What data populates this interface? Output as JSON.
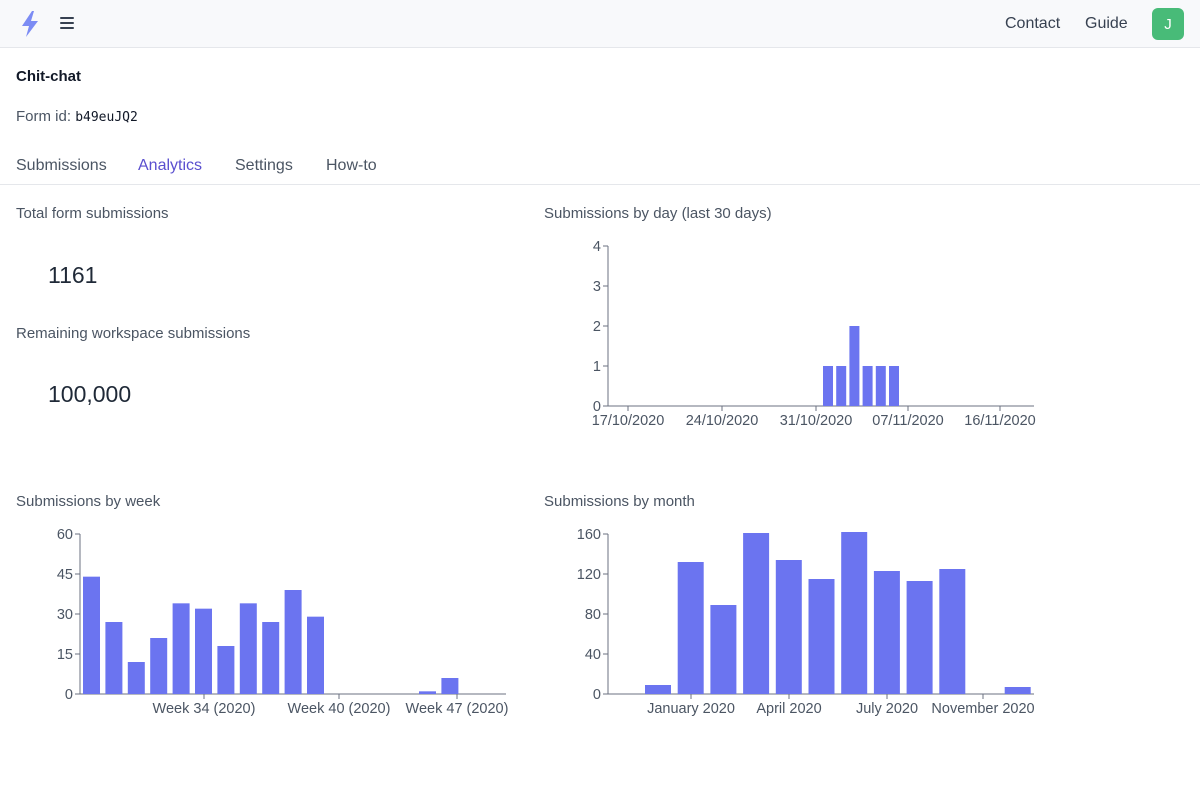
{
  "topbar": {
    "logo_icon": "lightning-bolt-icon",
    "menu_icon": "hamburger-menu-icon",
    "contact_label": "Contact",
    "guide_label": "Guide",
    "avatar_initial": "J",
    "avatar_color": "#48bb78"
  },
  "form": {
    "name": "Chit-chat",
    "id_label": "Form id:",
    "id_value": "b49euJQ2"
  },
  "tabs": [
    {
      "label": "Submissions",
      "active": false
    },
    {
      "label": "Analytics",
      "active": true
    },
    {
      "label": "Settings",
      "active": false
    },
    {
      "label": "How-to",
      "active": false
    }
  ],
  "stats": {
    "total_label": "Total form submissions",
    "total_value": "1161",
    "remaining_label": "Remaining workspace submissions",
    "remaining_value": "100,000"
  },
  "charts": {
    "day_title": "Submissions by day (last 30 days)",
    "week_title": "Submissions by week",
    "month_title": "Submissions by month"
  },
  "bar_color": "#6b74f0",
  "chart_data": [
    {
      "type": "bar",
      "title": "Submissions by day (last 30 days)",
      "x_tick_labels": [
        "17/10/2020",
        "24/10/2020",
        "31/10/2020",
        "07/11/2020",
        "16/11/2020"
      ],
      "y_ticks": [
        0,
        1,
        2,
        3,
        4
      ],
      "ylim": [
        0,
        4
      ],
      "categories": [
        "2020-11-01",
        "2020-11-02",
        "2020-11-03",
        "2020-11-04",
        "2020-11-05",
        "2020-11-06"
      ],
      "values": [
        1,
        1,
        2,
        1,
        1,
        1
      ]
    },
    {
      "type": "bar",
      "title": "Submissions by week",
      "x_tick_labels": [
        "Week 34 (2020)",
        "Week 40 (2020)",
        "Week 47 (2020)"
      ],
      "y_ticks": [
        0,
        15,
        30,
        45,
        60
      ],
      "ylim": [
        0,
        60
      ],
      "categories": [
        "Week 31",
        "Week 32",
        "Week 33",
        "Week 34",
        "Week 35",
        "Week 36",
        "Week 37",
        "Week 38",
        "Week 39",
        "Week 40",
        "Week 41",
        "Week 42",
        "Week 43",
        "Week 44",
        "Week 45",
        "Week 46",
        "Week 47",
        "Week 48",
        "Week 49"
      ],
      "values": [
        44,
        27,
        12,
        21,
        34,
        32,
        18,
        34,
        27,
        39,
        29,
        0,
        0,
        0,
        0,
        1,
        6,
        0,
        0
      ]
    },
    {
      "type": "bar",
      "title": "Submissions by month",
      "x_tick_labels": [
        "January 2020",
        "April 2020",
        "July 2020",
        "November 2020"
      ],
      "y_ticks": [
        0,
        40,
        80,
        120,
        160
      ],
      "ylim": [
        0,
        160
      ],
      "categories": [
        "2019-12",
        "2020-01",
        "2020-02",
        "2020-03",
        "2020-04",
        "2020-05",
        "2020-06",
        "2020-07",
        "2020-08",
        "2020-09",
        "2020-10",
        "2020-11"
      ],
      "values": [
        9,
        132,
        89,
        161,
        134,
        115,
        162,
        123,
        113,
        125,
        0,
        7
      ]
    }
  ]
}
